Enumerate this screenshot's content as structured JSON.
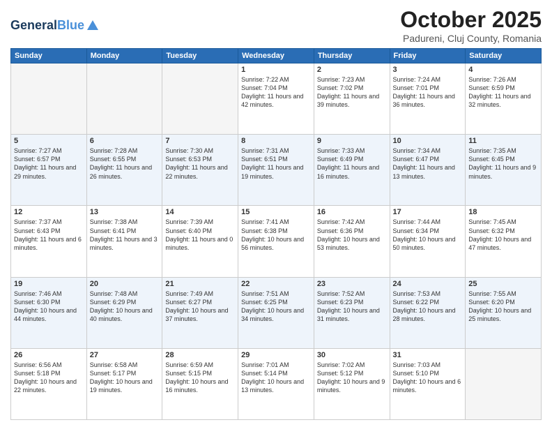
{
  "header": {
    "logo_line1": "General",
    "logo_line2": "Blue",
    "month": "October 2025",
    "location": "Padureni, Cluj County, Romania"
  },
  "weekdays": [
    "Sunday",
    "Monday",
    "Tuesday",
    "Wednesday",
    "Thursday",
    "Friday",
    "Saturday"
  ],
  "weeks": [
    [
      {
        "day": "",
        "info": ""
      },
      {
        "day": "",
        "info": ""
      },
      {
        "day": "",
        "info": ""
      },
      {
        "day": "1",
        "info": "Sunrise: 7:22 AM\nSunset: 7:04 PM\nDaylight: 11 hours and 42 minutes."
      },
      {
        "day": "2",
        "info": "Sunrise: 7:23 AM\nSunset: 7:02 PM\nDaylight: 11 hours and 39 minutes."
      },
      {
        "day": "3",
        "info": "Sunrise: 7:24 AM\nSunset: 7:01 PM\nDaylight: 11 hours and 36 minutes."
      },
      {
        "day": "4",
        "info": "Sunrise: 7:26 AM\nSunset: 6:59 PM\nDaylight: 11 hours and 32 minutes."
      }
    ],
    [
      {
        "day": "5",
        "info": "Sunrise: 7:27 AM\nSunset: 6:57 PM\nDaylight: 11 hours and 29 minutes."
      },
      {
        "day": "6",
        "info": "Sunrise: 7:28 AM\nSunset: 6:55 PM\nDaylight: 11 hours and 26 minutes."
      },
      {
        "day": "7",
        "info": "Sunrise: 7:30 AM\nSunset: 6:53 PM\nDaylight: 11 hours and 22 minutes."
      },
      {
        "day": "8",
        "info": "Sunrise: 7:31 AM\nSunset: 6:51 PM\nDaylight: 11 hours and 19 minutes."
      },
      {
        "day": "9",
        "info": "Sunrise: 7:33 AM\nSunset: 6:49 PM\nDaylight: 11 hours and 16 minutes."
      },
      {
        "day": "10",
        "info": "Sunrise: 7:34 AM\nSunset: 6:47 PM\nDaylight: 11 hours and 13 minutes."
      },
      {
        "day": "11",
        "info": "Sunrise: 7:35 AM\nSunset: 6:45 PM\nDaylight: 11 hours and 9 minutes."
      }
    ],
    [
      {
        "day": "12",
        "info": "Sunrise: 7:37 AM\nSunset: 6:43 PM\nDaylight: 11 hours and 6 minutes."
      },
      {
        "day": "13",
        "info": "Sunrise: 7:38 AM\nSunset: 6:41 PM\nDaylight: 11 hours and 3 minutes."
      },
      {
        "day": "14",
        "info": "Sunrise: 7:39 AM\nSunset: 6:40 PM\nDaylight: 11 hours and 0 minutes."
      },
      {
        "day": "15",
        "info": "Sunrise: 7:41 AM\nSunset: 6:38 PM\nDaylight: 10 hours and 56 minutes."
      },
      {
        "day": "16",
        "info": "Sunrise: 7:42 AM\nSunset: 6:36 PM\nDaylight: 10 hours and 53 minutes."
      },
      {
        "day": "17",
        "info": "Sunrise: 7:44 AM\nSunset: 6:34 PM\nDaylight: 10 hours and 50 minutes."
      },
      {
        "day": "18",
        "info": "Sunrise: 7:45 AM\nSunset: 6:32 PM\nDaylight: 10 hours and 47 minutes."
      }
    ],
    [
      {
        "day": "19",
        "info": "Sunrise: 7:46 AM\nSunset: 6:30 PM\nDaylight: 10 hours and 44 minutes."
      },
      {
        "day": "20",
        "info": "Sunrise: 7:48 AM\nSunset: 6:29 PM\nDaylight: 10 hours and 40 minutes."
      },
      {
        "day": "21",
        "info": "Sunrise: 7:49 AM\nSunset: 6:27 PM\nDaylight: 10 hours and 37 minutes."
      },
      {
        "day": "22",
        "info": "Sunrise: 7:51 AM\nSunset: 6:25 PM\nDaylight: 10 hours and 34 minutes."
      },
      {
        "day": "23",
        "info": "Sunrise: 7:52 AM\nSunset: 6:23 PM\nDaylight: 10 hours and 31 minutes."
      },
      {
        "day": "24",
        "info": "Sunrise: 7:53 AM\nSunset: 6:22 PM\nDaylight: 10 hours and 28 minutes."
      },
      {
        "day": "25",
        "info": "Sunrise: 7:55 AM\nSunset: 6:20 PM\nDaylight: 10 hours and 25 minutes."
      }
    ],
    [
      {
        "day": "26",
        "info": "Sunrise: 6:56 AM\nSunset: 5:18 PM\nDaylight: 10 hours and 22 minutes."
      },
      {
        "day": "27",
        "info": "Sunrise: 6:58 AM\nSunset: 5:17 PM\nDaylight: 10 hours and 19 minutes."
      },
      {
        "day": "28",
        "info": "Sunrise: 6:59 AM\nSunset: 5:15 PM\nDaylight: 10 hours and 16 minutes."
      },
      {
        "day": "29",
        "info": "Sunrise: 7:01 AM\nSunset: 5:14 PM\nDaylight: 10 hours and 13 minutes."
      },
      {
        "day": "30",
        "info": "Sunrise: 7:02 AM\nSunset: 5:12 PM\nDaylight: 10 hours and 9 minutes."
      },
      {
        "day": "31",
        "info": "Sunrise: 7:03 AM\nSunset: 5:10 PM\nDaylight: 10 hours and 6 minutes."
      },
      {
        "day": "",
        "info": ""
      }
    ]
  ]
}
